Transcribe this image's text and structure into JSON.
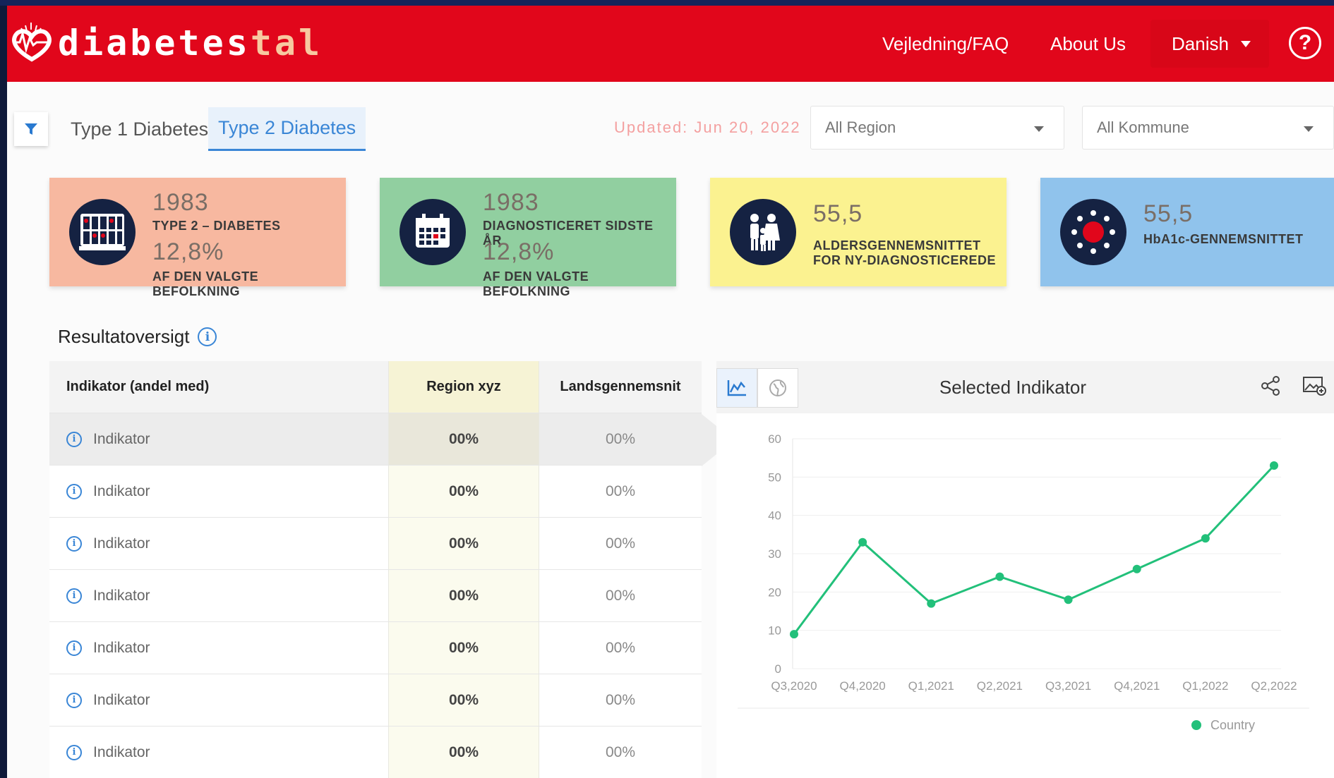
{
  "brand": {
    "name_main": "diabetes",
    "name_tail": "tal"
  },
  "nav": {
    "faq": "Vejledning/FAQ",
    "about": "About Us",
    "language": "Danish",
    "help": "?"
  },
  "tabs": [
    {
      "label": "Type 1 Diabetes",
      "active": false
    },
    {
      "label": "Type 2 Diabetes",
      "active": true
    }
  ],
  "updated": "Updated: Jun 20, 2022",
  "filters": {
    "region": "All Region",
    "kommune": "All Kommune"
  },
  "cards": [
    {
      "value1": "1983",
      "label1": "TYPE 2 – DIABETES",
      "value2": "12,8%",
      "label2": "AF DEN VALGTE BEFOLKNING",
      "color": "#f7b8a0",
      "icon": "population-grid-icon"
    },
    {
      "value1": "1983",
      "label1": "DIAGNOSTICERET SIDSTE ÅR",
      "value2": "12,8%",
      "label2": "AF DEN VALGTE BEFOLKNING",
      "color": "#91cfa0",
      "icon": "calendar-icon"
    },
    {
      "value1": "55,5",
      "label1": "ALDERSGENNEMSNITTET",
      "label2": "FOR NY-DIAGNOSTICEREDE",
      "color": "#fbf290",
      "icon": "family-icon"
    },
    {
      "value1": "55,5",
      "label1": "HbA1c-GENNEMSNITTET",
      "color": "#90c3ec",
      "icon": "blood-drop-icon"
    }
  ],
  "section": {
    "title": "Resultatoversigt"
  },
  "table": {
    "headers": [
      "Indikator (andel med)",
      "Region xyz",
      "Landsgennemsnit"
    ],
    "rows": [
      {
        "indicator": "Indikator",
        "region": "00%",
        "national": "00%"
      },
      {
        "indicator": "Indikator",
        "region": "00%",
        "national": "00%"
      },
      {
        "indicator": "Indikator",
        "region": "00%",
        "national": "00%"
      },
      {
        "indicator": "Indikator",
        "region": "00%",
        "national": "00%"
      },
      {
        "indicator": "Indikator",
        "region": "00%",
        "national": "00%"
      },
      {
        "indicator": "Indikator",
        "region": "00%",
        "national": "00%"
      },
      {
        "indicator": "Indikator",
        "region": "00%",
        "national": "00%"
      }
    ]
  },
  "chart_panel": {
    "title": "Selected Indikator"
  },
  "chart_data": {
    "type": "line",
    "x": [
      "Q3,2020",
      "Q4,2020",
      "Q1,2021",
      "Q2,2021",
      "Q3,2021",
      "Q4,2021",
      "Q1,2022",
      "Q2,2022"
    ],
    "series": [
      {
        "name": "Country",
        "values": [
          9,
          33,
          17,
          24,
          18,
          26,
          34,
          53
        ],
        "color": "#22c07a"
      }
    ],
    "ylim": [
      0,
      60
    ],
    "yticks": [
      0,
      10,
      20,
      30,
      40,
      50,
      60
    ],
    "grid": true,
    "legend": "bottom-right"
  }
}
